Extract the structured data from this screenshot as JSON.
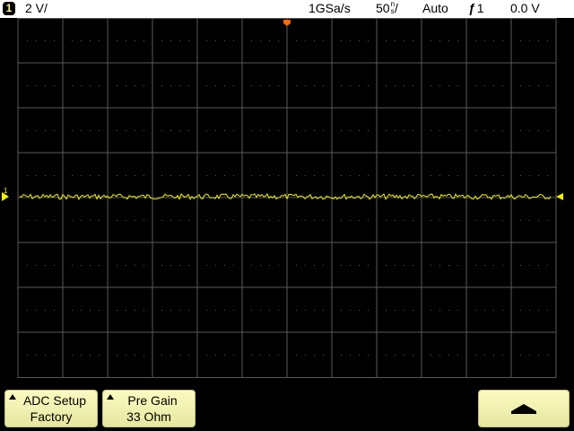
{
  "status": {
    "channel": "1",
    "vertical_scale": "2 V/",
    "sample_rate": "1GSa/s",
    "timebase_value": "50",
    "timebase_unit_top": "n",
    "timebase_unit_bottom": "s",
    "timebase_slash": "/",
    "trigger_mode": "Auto",
    "trigger_source": "1",
    "trigger_level": "0.0 V"
  },
  "marker": {
    "ground_label": "1"
  },
  "softkeys": {
    "adc_setup_label": "ADC Setup",
    "adc_setup_value": "Factory",
    "pre_gain_label": "Pre Gain",
    "pre_gain_value": "33 Ohm"
  },
  "colors": {
    "trace": "#f2f200",
    "grid": "#5a5a5a",
    "trigger_marker": "#ff6a00",
    "softkey": "#f6f6b6"
  },
  "icons": {
    "trigger_edge": "rising-edge-icon",
    "up_arrow": "up-arrow-icon"
  }
}
